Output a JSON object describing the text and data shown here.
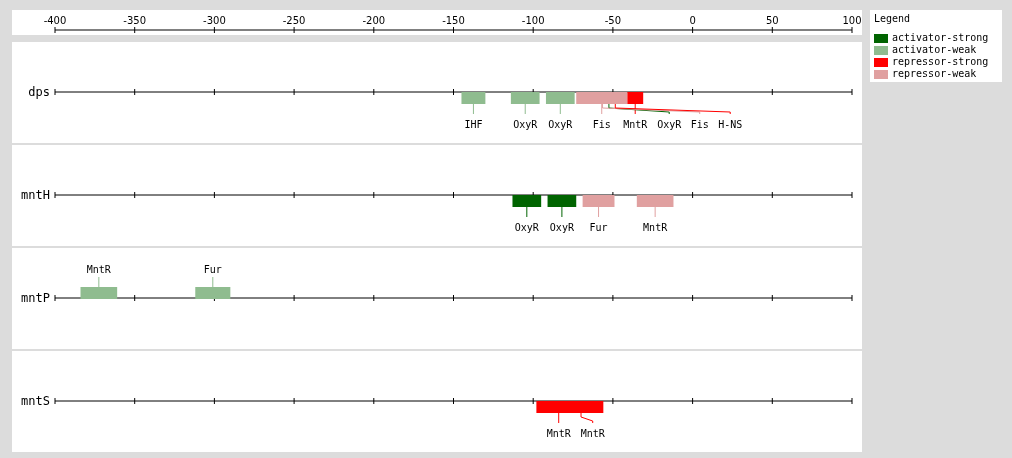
{
  "axis": {
    "ticks": [
      "-400",
      "-350",
      "-300",
      "-250",
      "-200",
      "-150",
      "-100",
      "-50",
      "0",
      "50",
      "100"
    ]
  },
  "legend": {
    "title": "Legend",
    "items": [
      {
        "label": "activator-strong",
        "color": "#006400"
      },
      {
        "label": "activator-weak",
        "color": "#8fbc8f"
      },
      {
        "label": "repressor-strong",
        "color": "#ff0000"
      },
      {
        "label": "repressor-weak",
        "color": "#e0a0a0"
      }
    ]
  },
  "genes": [
    {
      "name": "dps",
      "sites": [
        {
          "label": "IHF",
          "kind": "activator-weak"
        },
        {
          "label": "OxyR",
          "kind": "activator-weak"
        },
        {
          "label": "OxyR",
          "kind": "activator-weak"
        },
        {
          "label": "Fis",
          "kind": "repressor-weak"
        },
        {
          "label": "MntR",
          "kind": "repressor-strong"
        },
        {
          "label": "OxyR",
          "kind": "activator-strong"
        },
        {
          "label": "Fis",
          "kind": "repressor-weak"
        },
        {
          "label": "H-NS",
          "kind": "repressor-strong"
        }
      ]
    },
    {
      "name": "mntH",
      "sites": [
        {
          "label": "OxyR",
          "kind": "activator-strong"
        },
        {
          "label": "OxyR",
          "kind": "activator-strong"
        },
        {
          "label": "Fur",
          "kind": "repressor-weak"
        },
        {
          "label": "MntR",
          "kind": "repressor-weak"
        }
      ]
    },
    {
      "name": "mntP",
      "sites": [
        {
          "label": "MntR",
          "kind": "activator-weak"
        },
        {
          "label": "Fur",
          "kind": "activator-weak"
        }
      ]
    },
    {
      "name": "mntS",
      "sites": [
        {
          "label": "MntR",
          "kind": "repressor-strong"
        },
        {
          "label": "MntR",
          "kind": "repressor-strong"
        }
      ]
    }
  ]
}
